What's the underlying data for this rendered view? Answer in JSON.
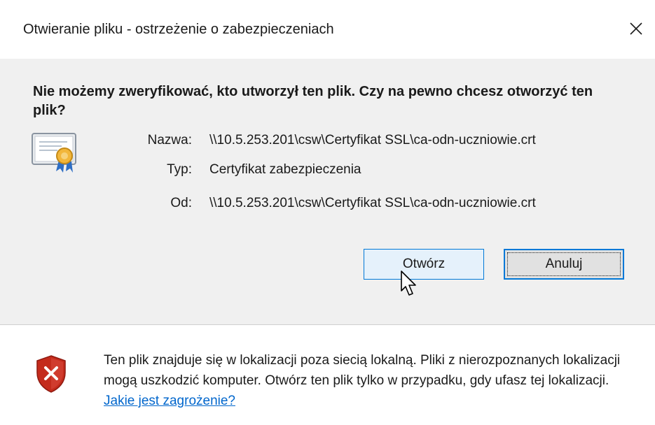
{
  "dialog": {
    "title": "Otwieranie pliku - ostrzeżenie o zabezpieczeniach",
    "close_icon": "close-icon"
  },
  "main": {
    "headline": "Nie możemy zweryfikować, kto utworzył ten plik. Czy na pewno chcesz otworzyć ten plik?",
    "file_icon": "certificate-icon",
    "details": [
      {
        "label": "Nazwa:",
        "value": "\\\\10.5.253.201\\csw\\Certyfikat SSL\\ca-odn-uczniowie.crt"
      },
      {
        "label": "Typ:",
        "value": "Certyfikat zabezpieczenia"
      },
      {
        "label": "Od:",
        "value": "\\\\10.5.253.201\\csw\\Certyfikat SSL\\ca-odn-uczniowie.crt"
      }
    ],
    "buttons": {
      "open": "Otwórz",
      "cancel": "Anuluj"
    }
  },
  "footer": {
    "icon": "security-warning-shield-icon",
    "warning": "Ten plik znajduje się w lokalizacji poza siecią lokalną. Pliki z nierozpoznanych lokalizacji mogą uszkodzić komputer. Otwórz ten plik tylko w przypadku, gdy ufasz tej lokalizacji.",
    "link": "Jakie jest zagrożenie?"
  },
  "colors": {
    "accent": "#0078d7",
    "link": "#0066cc",
    "dialog_body": "#f0f0f0",
    "shield_red": "#c42b1c"
  }
}
